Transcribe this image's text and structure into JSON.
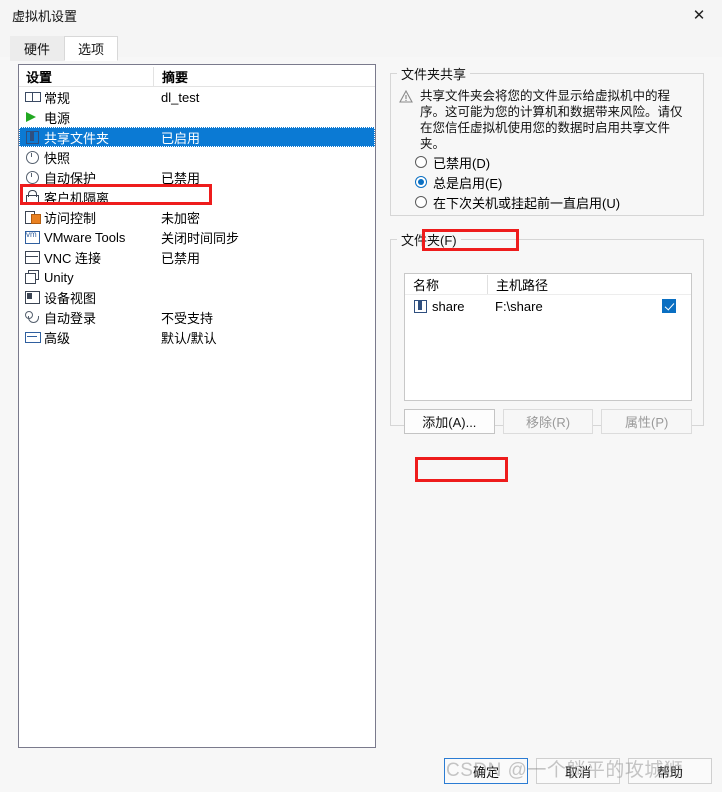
{
  "window": {
    "title": "虚拟机设置",
    "close_icon": "close-icon"
  },
  "tabs": [
    {
      "label": "硬件",
      "active": false
    },
    {
      "label": "选项",
      "active": true
    }
  ],
  "settings_list": {
    "headers": {
      "name": "设置",
      "summary": "摘要"
    },
    "rows": [
      {
        "icon": "monitor-icon",
        "label": "常规",
        "summary": "dl_test",
        "selected": false
      },
      {
        "icon": "power-icon",
        "label": "电源",
        "summary": "",
        "selected": false
      },
      {
        "icon": "folder-icon",
        "label": "共享文件夹",
        "summary": "已启用",
        "selected": true
      },
      {
        "icon": "snapshot-icon",
        "label": "快照",
        "summary": "",
        "selected": false
      },
      {
        "icon": "autoprotect-icon",
        "label": "自动保护",
        "summary": "已禁用",
        "selected": false
      },
      {
        "icon": "lock-icon",
        "label": "客户机隔离",
        "summary": "",
        "selected": false
      },
      {
        "icon": "access-icon",
        "label": "访问控制",
        "summary": "未加密",
        "selected": false
      },
      {
        "icon": "vmware-tools-icon",
        "label": "VMware Tools",
        "summary": "关闭时间同步",
        "selected": false
      },
      {
        "icon": "vnc-icon",
        "label": "VNC 连接",
        "summary": "已禁用",
        "selected": false
      },
      {
        "icon": "unity-icon",
        "label": "Unity",
        "summary": "",
        "selected": false
      },
      {
        "icon": "device-view-icon",
        "label": "设备视图",
        "summary": "",
        "selected": false
      },
      {
        "icon": "autologin-icon",
        "label": "自动登录",
        "summary": "不受支持",
        "selected": false
      },
      {
        "icon": "advanced-icon",
        "label": "高级",
        "summary": "默认/默认",
        "selected": false
      }
    ]
  },
  "sharing_group": {
    "legend": "文件夹共享",
    "warning_icon": "warning-triangle-icon",
    "warning_text": "共享文件夹会将您的文件显示给虚拟机中的程序。这可能为您的计算机和数据带来风险。请仅在您信任虚拟机使用您的数据时启用共享文件夹。",
    "options": [
      {
        "label": "已禁用(D)",
        "text": "已禁用",
        "mnemonic": "(D)",
        "checked": false
      },
      {
        "label": "总是启用(E)",
        "text": "总是启用",
        "mnemonic": "(E)",
        "checked": true
      },
      {
        "label": "在下次关机或挂起前一直启用(U)",
        "text": "在下次关机或挂起前一直启用",
        "mnemonic": "(U)",
        "checked": false
      }
    ]
  },
  "folders_group": {
    "legend": "文件夹(F)",
    "headers": {
      "name": "名称",
      "path": "主机路径",
      "enabled": ""
    },
    "rows": [
      {
        "icon": "folder-icon",
        "name": "share",
        "path": "F:\\share",
        "enabled": true
      }
    ],
    "buttons": [
      {
        "label": "添加(A)...",
        "disabled": false
      },
      {
        "label": "移除(R)",
        "disabled": true
      },
      {
        "label": "属性(P)",
        "disabled": true
      }
    ]
  },
  "dialog_buttons": [
    {
      "label": "确定",
      "default": true
    },
    {
      "label": "取消",
      "default": false
    },
    {
      "label": "帮助",
      "default": false
    }
  ],
  "watermark": {
    "text": "CSDN @一个躺平的攻城狮"
  },
  "colors": {
    "selection_blue": "#0b7ad4",
    "accent_blue": "#0a6fc2",
    "annotation_red": "#ee1c1c",
    "mnemonic_blue": "#2b5fb8"
  }
}
